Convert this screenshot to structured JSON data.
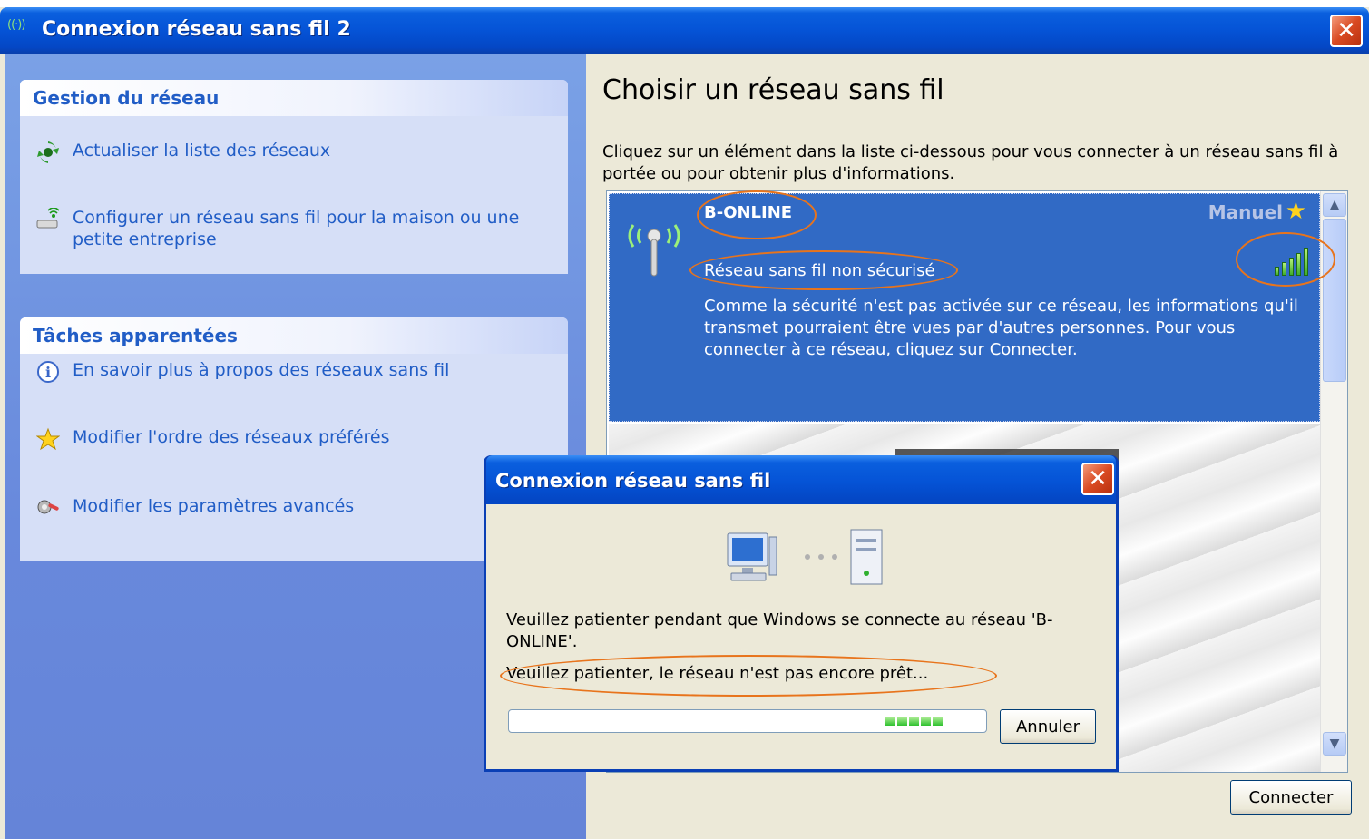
{
  "window": {
    "title": "Connexion réseau sans fil 2",
    "title_icon": "((·))",
    "close_glyph": "✕"
  },
  "sidebar": {
    "network_management": {
      "heading": "Gestion du réseau",
      "items": [
        {
          "label": "Actualiser la liste des réseaux",
          "icon": "refresh-icon"
        },
        {
          "label": "Configurer un réseau sans fil pour la maison ou une petite entreprise",
          "icon": "wireless-setup-icon"
        }
      ]
    },
    "related_tasks": {
      "heading": "Tâches apparentées",
      "items": [
        {
          "label": "En savoir plus à propos des réseaux sans fil",
          "icon": "info-icon"
        },
        {
          "label": "Modifier l'ordre des réseaux préférés",
          "icon": "star-icon"
        },
        {
          "label": "Modifier les paramètres avancés",
          "icon": "advanced-settings-icon"
        }
      ]
    }
  },
  "main": {
    "heading": "Choisir un réseau sans fil",
    "instructions": "Cliquez sur un élément dans la liste ci-dessous pour vous connecter à un réseau sans fil à portée ou pour obtenir plus d'informations.",
    "networks": [
      {
        "name": "B-ONLINE",
        "mode": "Manuel",
        "security": "Réseau sans fil non sécurisé",
        "description": "Comme la sécurité n'est pas activée sur ce réseau, les informations qu'il transmet pourraient être vues par d'autres personnes. Pour vous connecter à ce réseau, cliquez sur Connecter.",
        "selected": true,
        "preferred": true
      }
    ],
    "connect_button": "Connecter"
  },
  "dialog": {
    "title": "Connexion réseau sans fil",
    "message": "Veuillez patienter pendant que Windows se connecte au réseau 'B-ONLINE'.",
    "status": "Veuillez patienter, le réseau n'est pas encore prêt...",
    "cancel_button": "Annuler",
    "close_glyph": "✕"
  },
  "colors": {
    "xp_blue": "#0553d6",
    "selection": "#316ac5",
    "highlight_ellipse": "#e8741c",
    "task_link": "#215dc6"
  }
}
